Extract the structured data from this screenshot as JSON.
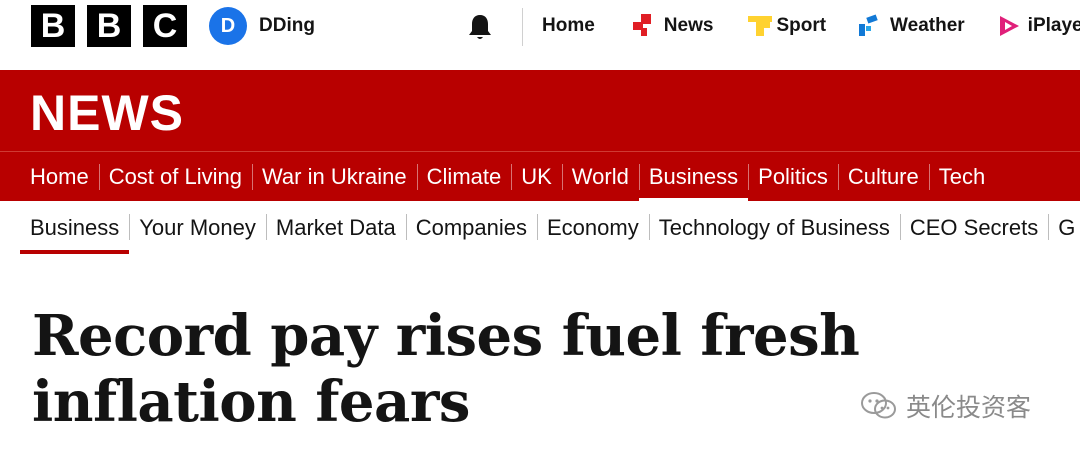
{
  "brand": {
    "letters": [
      "B",
      "B",
      "C"
    ]
  },
  "account": {
    "initial": "D",
    "name": "DDing"
  },
  "top_nav": [
    {
      "label": "Home",
      "icon": "none"
    },
    {
      "label": "News",
      "icon": "news-icon"
    },
    {
      "label": "Sport",
      "icon": "sport-icon"
    },
    {
      "label": "Weather",
      "icon": "weather-icon"
    },
    {
      "label": "iPlayer",
      "icon": "iplayer-icon"
    }
  ],
  "section_title": "NEWS",
  "news_nav": [
    "Home",
    "Cost of Living",
    "War in Ukraine",
    "Climate",
    "UK",
    "World",
    "Business",
    "Politics",
    "Culture",
    "Tech"
  ],
  "news_nav_active": "Business",
  "sub_nav": [
    "Business",
    "Your Money",
    "Market Data",
    "Companies",
    "Economy",
    "Technology of Business",
    "CEO Secrets",
    "G"
  ],
  "sub_nav_active": "Business",
  "headline": "Record pay rises fuel fresh inflation fears",
  "watermark": "英伦投资客",
  "colors": {
    "news_red": "#b80000",
    "avatar_blue": "#1a73e8",
    "sport_yellow": "#ffd230",
    "weather_blue": "#1279d6",
    "iplayer_pink": "#e0207a"
  }
}
